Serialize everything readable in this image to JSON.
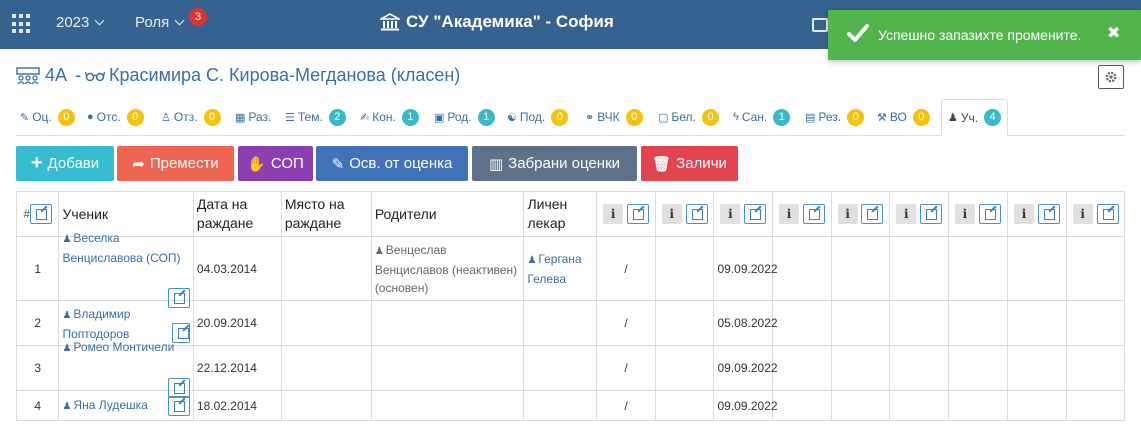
{
  "header": {
    "year": "2023",
    "role_label": "Роля",
    "role_badge": "3",
    "school_name": "СУ \"Академика\" - София"
  },
  "toast": {
    "message": "Успешно запазихте промените.",
    "close": "✖"
  },
  "class_title": {
    "class_name": "4А",
    "teacher": "Красимира С. Кирова-Мегданова (класен)"
  },
  "tabs": [
    {
      "icon": "✎",
      "label": "Оц.",
      "count": "0",
      "badge_color": "yellow"
    },
    {
      "icon": "●",
      "label": "Отс.",
      "count": "0",
      "badge_color": "yellow"
    },
    {
      "icon": "♙",
      "label": "Отз.",
      "count": "0",
      "badge_color": "yellow"
    },
    {
      "icon": "▦",
      "label": "Раз.",
      "count": "",
      "badge_color": ""
    },
    {
      "icon": "☰",
      "label": "Тем.",
      "count": "2",
      "badge_color": "teal"
    },
    {
      "icon": "✍",
      "label": "Кон.",
      "count": "1",
      "badge_color": "teal"
    },
    {
      "icon": "▣",
      "label": "Род.",
      "count": "1",
      "badge_color": "teal"
    },
    {
      "icon": "☯",
      "label": "Под.",
      "count": "0",
      "badge_color": "yellow"
    },
    {
      "icon": "⚭",
      "label": "ВЧК",
      "count": "0",
      "badge_color": "yellow"
    },
    {
      "icon": "▢",
      "label": "Бел.",
      "count": "0",
      "badge_color": "yellow"
    },
    {
      "icon": "ϟ",
      "label": "Сан.",
      "count": "1",
      "badge_color": "teal"
    },
    {
      "icon": "▤",
      "label": "Рез.",
      "count": "0",
      "badge_color": "yellow"
    },
    {
      "icon": "⚒",
      "label": "ВО",
      "count": "0",
      "badge_color": "yellow"
    },
    {
      "icon": "♟",
      "label": "Уч.",
      "count": "4",
      "badge_color": "teal",
      "active": true
    }
  ],
  "actions": {
    "add": "Добави",
    "move": "Премести",
    "sop": "СОП",
    "exempt": "Осв. от оценка",
    "forbidden": "Забрани оценки",
    "delete": "Заличи"
  },
  "colors": {
    "header": "#35628f",
    "toast": "#52b44d",
    "add": "#35bcd1",
    "move": "#ef6452",
    "sop": "#8b3fb0",
    "exempt": "#3f72b6",
    "forbidden": "#5f7188",
    "delete": "#e2444f"
  },
  "table": {
    "headers": {
      "num_sign": "#",
      "student": "Ученик",
      "birth_date": "Дата на раждане",
      "birth_place": "Място на раждане",
      "parents": "Родители",
      "doctor": "Личен лекар"
    },
    "rows": [
      {
        "num": "1",
        "student": "Веселка Венциславова (СОП)",
        "birth_date": "04.03.2014",
        "birth_place": "",
        "parents": "Венцеслав Венциславов (неактивен) (основен)",
        "doctor": "Гергана Гелева",
        "col1": "/",
        "col3": "09.09.2022"
      },
      {
        "num": "2",
        "student": "Владимир Поптодоров",
        "birth_date": "20.09.2014",
        "birth_place": "",
        "parents": "",
        "doctor": "",
        "col1": "/",
        "col3": "05.08.2022"
      },
      {
        "num": "3",
        "student": "Ромео Монтичели",
        "birth_date": "22.12.2014",
        "birth_place": "",
        "parents": "",
        "doctor": "",
        "col1": "/",
        "col3": "09.09.2022"
      },
      {
        "num": "4",
        "student": "Яна Лудешка",
        "birth_date": "18.02.2014",
        "birth_place": "",
        "parents": "",
        "doctor": "",
        "col1": "/",
        "col3": "09.09.2022"
      }
    ]
  }
}
